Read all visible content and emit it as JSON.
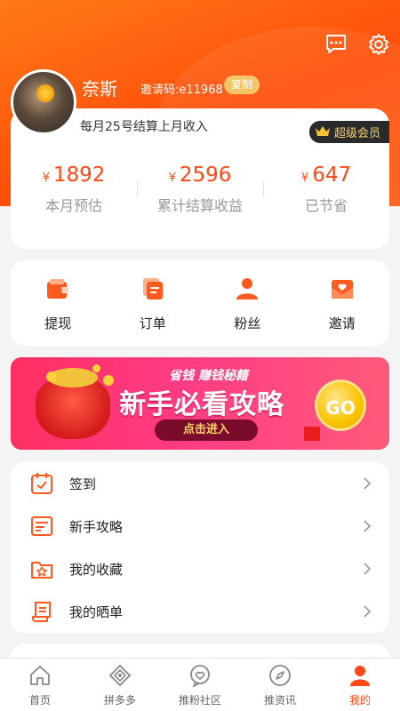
{
  "colors": {
    "accent": "#ff4a17",
    "hero": "#ff6a12",
    "vip_gold": "#f7d26a",
    "copy_btn": "#f3c66a"
  },
  "profile": {
    "username": "奈斯",
    "invite_code": "邀请码:e11968",
    "copy_label": "复制",
    "settle_note": "每月25号结算上月收入",
    "vip_label": "超级会员"
  },
  "stats": [
    {
      "currency": "¥",
      "value": "1892",
      "label": "本月预估"
    },
    {
      "currency": "¥",
      "value": "2596",
      "label": "累计结算收益"
    },
    {
      "currency": "¥",
      "value": "647",
      "label": "已节省"
    }
  ],
  "quick_actions": [
    {
      "icon": "wallet-icon",
      "label": "提现"
    },
    {
      "icon": "order-icon",
      "label": "订单"
    },
    {
      "icon": "fans-icon",
      "label": "粉丝"
    },
    {
      "icon": "invite-icon",
      "label": "邀请"
    }
  ],
  "banner": {
    "subtitle": "省钱 赚钱秘籍",
    "title": "新手必看攻略",
    "enter_label": "点击进入",
    "go_label": "GO"
  },
  "menu": [
    {
      "icon": "calendar-check-icon",
      "label": "签到"
    },
    {
      "icon": "guide-doc-icon",
      "label": "新手攻略"
    },
    {
      "icon": "folder-star-icon",
      "label": "我的收藏"
    },
    {
      "icon": "scroll-icon",
      "label": "我的晒单"
    }
  ],
  "tabbar": [
    {
      "icon": "home-icon",
      "label": "首页",
      "active": false
    },
    {
      "icon": "pinduoduo-icon",
      "label": "拼多多",
      "active": false
    },
    {
      "icon": "community-icon",
      "label": "推粉社区",
      "active": false
    },
    {
      "icon": "compass-icon",
      "label": "推资讯",
      "active": false
    },
    {
      "icon": "person-icon",
      "label": "我的",
      "active": true
    }
  ]
}
